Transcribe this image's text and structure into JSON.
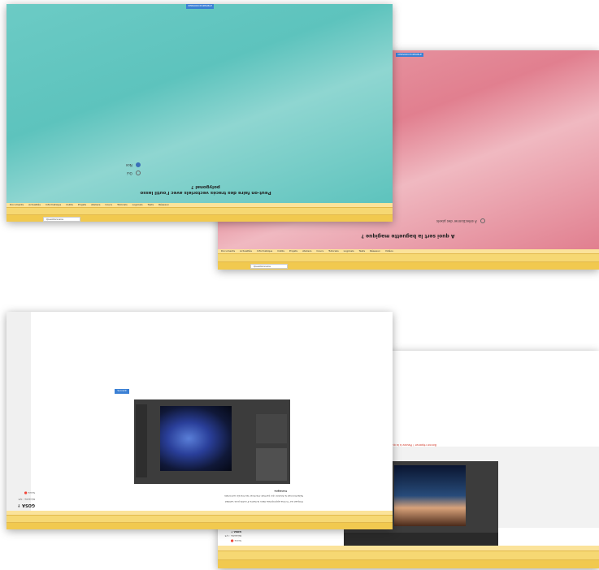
{
  "top_left": {
    "button": "VERSION PORTABLE",
    "question_line1": "Peut-on faire des tracés vectoriels avec l’outil lasso",
    "question_line2": "polygonal ?",
    "options": [
      "Non",
      "Oui"
    ],
    "selected_option": 0,
    "bg_color": "#5dc3bd",
    "tab": "Questionnaire",
    "bookmarks": [
      "Documents",
      "Actualités",
      "Informatique",
      "Actualités",
      "Outils",
      "Projets",
      "Ateliers",
      "Cours",
      "Tutoriels",
      "Logiciels",
      "Tests",
      "Réseaux",
      "Vidéos",
      "Sites web",
      "Applications",
      "Autres"
    ]
  },
  "top_right": {
    "button": "VERSION PORTABLE",
    "question": "À quoi sert la baguette magique ?",
    "option": "À sélectionner des pixels",
    "bg_color": "#e17f8f",
    "tab": "Questionnaire"
  },
  "bottom_left": {
    "button": "Suivant",
    "score_label": "Score 🔴",
    "score_sub": "Réussite : 0/3",
    "logo": "GOSA ↑",
    "caption_title": "Consigne",
    "caption_line1": "Sélectionnez le bouton qui permet d’activer les tracés vectoriels",
    "caption_line2": "Cliquez sur l’icône appropriée dans la barre d’outils puis validez"
  },
  "bottom_right": {
    "notice": "Bonne réponse ! Passez à la question suivante",
    "score_label": "Score 🔴",
    "score_sub": "Réussite : 1/3",
    "logo": "GOSA ↑"
  }
}
